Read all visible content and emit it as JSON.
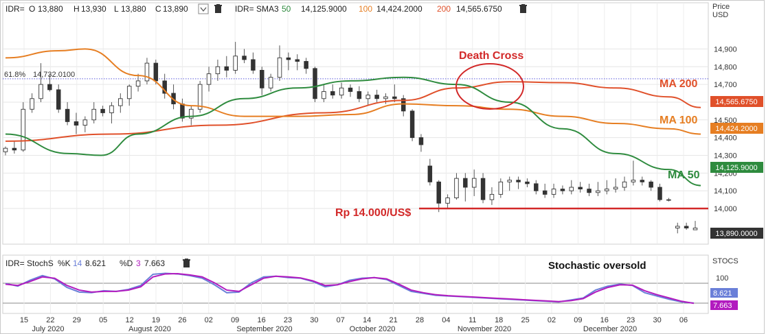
{
  "header": {
    "symbol": "IDR=",
    "ohlc": {
      "o_label": "O",
      "o": "13,880",
      "h_label": "H",
      "h": "13,930",
      "l_label": "L",
      "l": "13,880",
      "c_label": "C",
      "c": "13,890"
    },
    "sma_label": "IDR= SMA3",
    "sma": [
      {
        "period": "50",
        "value": "14,125.9000",
        "color": "#2e8b3e"
      },
      {
        "period": "100",
        "value": "14,424.2000",
        "color": "#e67e22"
      },
      {
        "period": "200",
        "value": "14,565.6750",
        "color": "#e0502a"
      }
    ]
  },
  "price_axis": {
    "title_line1": "Price",
    "title_line2": "USD"
  },
  "fib": {
    "label": "61.8%",
    "value": "14,732.0100"
  },
  "annotations": {
    "death_cross": "Death Cross",
    "ma200": "MA 200",
    "ma100": "MA 100",
    "ma50": "MA 50",
    "support": "Rp 14.000/US$",
    "stoch_note": "Stochastic oversold"
  },
  "price_tags": [
    {
      "text": "14,565.6750",
      "color": "#e0502a"
    },
    {
      "text": "14,424.2000",
      "color": "#e67e22"
    },
    {
      "text": "14,125.9000",
      "color": "#2e8b3e"
    },
    {
      "text": "13,890.0000",
      "color": "#333333"
    }
  ],
  "stoch_header": {
    "label": "IDR= StochS",
    "k_label": "%K",
    "k_period": "14",
    "k_value": "8.621",
    "d_label": "%D",
    "d_period": "3",
    "d_value": "7.663"
  },
  "stoch_axis": {
    "title": "STOCS",
    "tick": "100"
  },
  "stoch_tags": [
    {
      "text": "8.621",
      "color": "#6a7fd8"
    },
    {
      "text": "7.663",
      "color": "#b21bbf"
    }
  ],
  "chart_data": {
    "type": "candlestick",
    "y_ticks": [
      14000,
      14100,
      14200,
      14300,
      14400,
      14500,
      14600,
      14700,
      14800,
      14900
    ],
    "y_tick_labels": [
      "14,000",
      "14,100",
      "14,200",
      "14,300",
      "14,400",
      "14,500",
      "14,600",
      "14,700",
      "14,800",
      "14,900"
    ],
    "ylim": [
      13830,
      15020
    ],
    "x_ticks": [
      "15",
      "22",
      "29",
      "05",
      "12",
      "19",
      "26",
      "02",
      "09",
      "16",
      "23",
      "30",
      "07",
      "14",
      "21",
      "28",
      "04",
      "11",
      "18",
      "25",
      "02",
      "09",
      "16",
      "23",
      "30",
      "06"
    ],
    "months": [
      "July 2020",
      "August 2020",
      "September 2020",
      "October 2020",
      "November 2020",
      "December 2020"
    ],
    "support_level": 14000,
    "fib_level": 14732.01,
    "ma50": [
      [
        0,
        14420
      ],
      [
        12,
        14310
      ],
      [
        18,
        14300
      ],
      [
        25,
        14420
      ],
      [
        35,
        14520
      ],
      [
        45,
        14620
      ],
      [
        55,
        14680
      ],
      [
        65,
        14720
      ],
      [
        75,
        14740
      ],
      [
        85,
        14700
      ],
      [
        95,
        14600
      ],
      [
        105,
        14450
      ],
      [
        115,
        14310
      ],
      [
        125,
        14220
      ],
      [
        131,
        14130
      ]
    ],
    "ma100": [
      [
        0,
        14850
      ],
      [
        10,
        14890
      ],
      [
        15,
        14900
      ],
      [
        25,
        14750
      ],
      [
        35,
        14580
      ],
      [
        45,
        14520
      ],
      [
        55,
        14520
      ],
      [
        65,
        14530
      ],
      [
        75,
        14590
      ],
      [
        85,
        14580
      ],
      [
        95,
        14560
      ],
      [
        105,
        14520
      ],
      [
        115,
        14480
      ],
      [
        125,
        14450
      ],
      [
        131,
        14420
      ]
    ],
    "ma200": [
      [
        0,
        14380
      ],
      [
        20,
        14420
      ],
      [
        40,
        14470
      ],
      [
        60,
        14540
      ],
      [
        75,
        14610
      ],
      [
        85,
        14680
      ],
      [
        95,
        14715
      ],
      [
        105,
        14710
      ],
      [
        115,
        14680
      ],
      [
        125,
        14630
      ],
      [
        131,
        14570
      ]
    ],
    "candles": [
      [
        14320,
        14350,
        14300,
        14340
      ],
      [
        14340,
        14380,
        14310,
        14330
      ],
      [
        14330,
        14600,
        14320,
        14560
      ],
      [
        14560,
        14650,
        14540,
        14620
      ],
      [
        14620,
        14820,
        14600,
        14700
      ],
      [
        14700,
        14760,
        14660,
        14670
      ],
      [
        14670,
        14700,
        14540,
        14560
      ],
      [
        14560,
        14600,
        14470,
        14490
      ],
      [
        14490,
        14540,
        14420,
        14470
      ],
      [
        14470,
        14520,
        14430,
        14500
      ],
      [
        14500,
        14600,
        14480,
        14560
      ],
      [
        14560,
        14580,
        14520,
        14540
      ],
      [
        14540,
        14600,
        14480,
        14580
      ],
      [
        14580,
        14650,
        14540,
        14620
      ],
      [
        14620,
        14700,
        14580,
        14690
      ],
      [
        14690,
        14760,
        14660,
        14720
      ],
      [
        14720,
        14850,
        14700,
        14820
      ],
      [
        14820,
        14840,
        14700,
        14720
      ],
      [
        14720,
        14760,
        14620,
        14650
      ],
      [
        14650,
        14700,
        14560,
        14590
      ],
      [
        14590,
        14620,
        14490,
        14510
      ],
      [
        14510,
        14580,
        14470,
        14560
      ],
      [
        14560,
        14720,
        14540,
        14700
      ],
      [
        14700,
        14800,
        14660,
        14760
      ],
      [
        14760,
        14840,
        14720,
        14800
      ],
      [
        14800,
        14860,
        14740,
        14780
      ],
      [
        14780,
        14940,
        14760,
        14860
      ],
      [
        14860,
        14900,
        14820,
        14840
      ],
      [
        14840,
        14880,
        14760,
        14780
      ],
      [
        14780,
        14800,
        14640,
        14680
      ],
      [
        14680,
        14760,
        14660,
        14740
      ],
      [
        14740,
        14920,
        14720,
        14850
      ],
      [
        14850,
        14880,
        14780,
        14840
      ],
      [
        14840,
        14870,
        14780,
        14830
      ],
      [
        14830,
        14850,
        14760,
        14790
      ],
      [
        14790,
        14800,
        14600,
        14620
      ],
      [
        14620,
        14700,
        14600,
        14660
      ],
      [
        14660,
        14700,
        14620,
        14640
      ],
      [
        14640,
        14710,
        14620,
        14680
      ],
      [
        14680,
        14700,
        14630,
        14660
      ],
      [
        14660,
        14690,
        14600,
        14620
      ],
      [
        14620,
        14660,
        14580,
        14640
      ],
      [
        14640,
        14670,
        14600,
        14620
      ],
      [
        14620,
        14650,
        14590,
        14630
      ],
      [
        14630,
        14700,
        14600,
        14620
      ],
      [
        14620,
        14640,
        14520,
        14550
      ],
      [
        14550,
        14560,
        14380,
        14400
      ],
      [
        14400,
        14420,
        14320,
        14360
      ],
      [
        14240,
        14280,
        14130,
        14150
      ],
      [
        14150,
        14160,
        13980,
        14030
      ],
      [
        14030,
        14080,
        14000,
        14060
      ],
      [
        14060,
        14200,
        14050,
        14170
      ],
      [
        14170,
        14200,
        14040,
        14120
      ],
      [
        14120,
        14220,
        14070,
        14170
      ],
      [
        14170,
        14200,
        14030,
        14050
      ],
      [
        14050,
        14120,
        14020,
        14080
      ],
      [
        14080,
        14170,
        14060,
        14150
      ],
      [
        14150,
        14180,
        14100,
        14160
      ],
      [
        14160,
        14180,
        14110,
        14150
      ],
      [
        14150,
        14170,
        14120,
        14140
      ],
      [
        14140,
        14160,
        14080,
        14100
      ],
      [
        14100,
        14140,
        14060,
        14080
      ],
      [
        14080,
        14140,
        14060,
        14110
      ],
      [
        14110,
        14130,
        14080,
        14100
      ],
      [
        14100,
        14160,
        14080,
        14120
      ],
      [
        14120,
        14150,
        14090,
        14110
      ],
      [
        14110,
        14140,
        14070,
        14090
      ],
      [
        14090,
        14150,
        14070,
        14100
      ],
      [
        14100,
        14160,
        14080,
        14110
      ],
      [
        14110,
        14170,
        14090,
        14120
      ],
      [
        14120,
        14180,
        14100,
        14150
      ],
      [
        14150,
        14270,
        14130,
        14160
      ],
      [
        14160,
        14180,
        14130,
        14150
      ],
      [
        14150,
        14160,
        14100,
        14120
      ],
      [
        14120,
        14140,
        14040,
        14050
      ],
      [
        14050,
        14060,
        14040,
        14050
      ],
      [
        13890,
        13920,
        13860,
        13900
      ],
      [
        13900,
        13920,
        13880,
        13890
      ],
      [
        13880,
        13930,
        13880,
        13890
      ]
    ],
    "stoch_k": [
      68,
      60,
      78,
      92,
      82,
      56,
      42,
      40,
      46,
      44,
      50,
      62,
      96,
      99,
      97,
      92,
      84,
      64,
      40,
      42,
      70,
      88,
      90,
      86,
      84,
      74,
      58,
      64,
      78,
      84,
      86,
      80,
      62,
      44,
      38,
      32,
      30,
      28,
      26,
      24,
      22,
      20,
      18,
      16,
      14,
      12,
      18,
      24,
      48,
      60,
      66,
      62,
      40,
      30,
      20,
      12,
      8.621
    ],
    "stoch_d": [
      66,
      62,
      74,
      88,
      84,
      62,
      48,
      42,
      44,
      44,
      48,
      58,
      88,
      97,
      98,
      94,
      88,
      70,
      48,
      44,
      64,
      84,
      90,
      88,
      85,
      76,
      62,
      64,
      74,
      82,
      86,
      82,
      66,
      48,
      40,
      34,
      31,
      29,
      27,
      25,
      23,
      21,
      19,
      17,
      15,
      13,
      16,
      22,
      42,
      56,
      64,
      63,
      46,
      34,
      24,
      14,
      7.663
    ]
  }
}
